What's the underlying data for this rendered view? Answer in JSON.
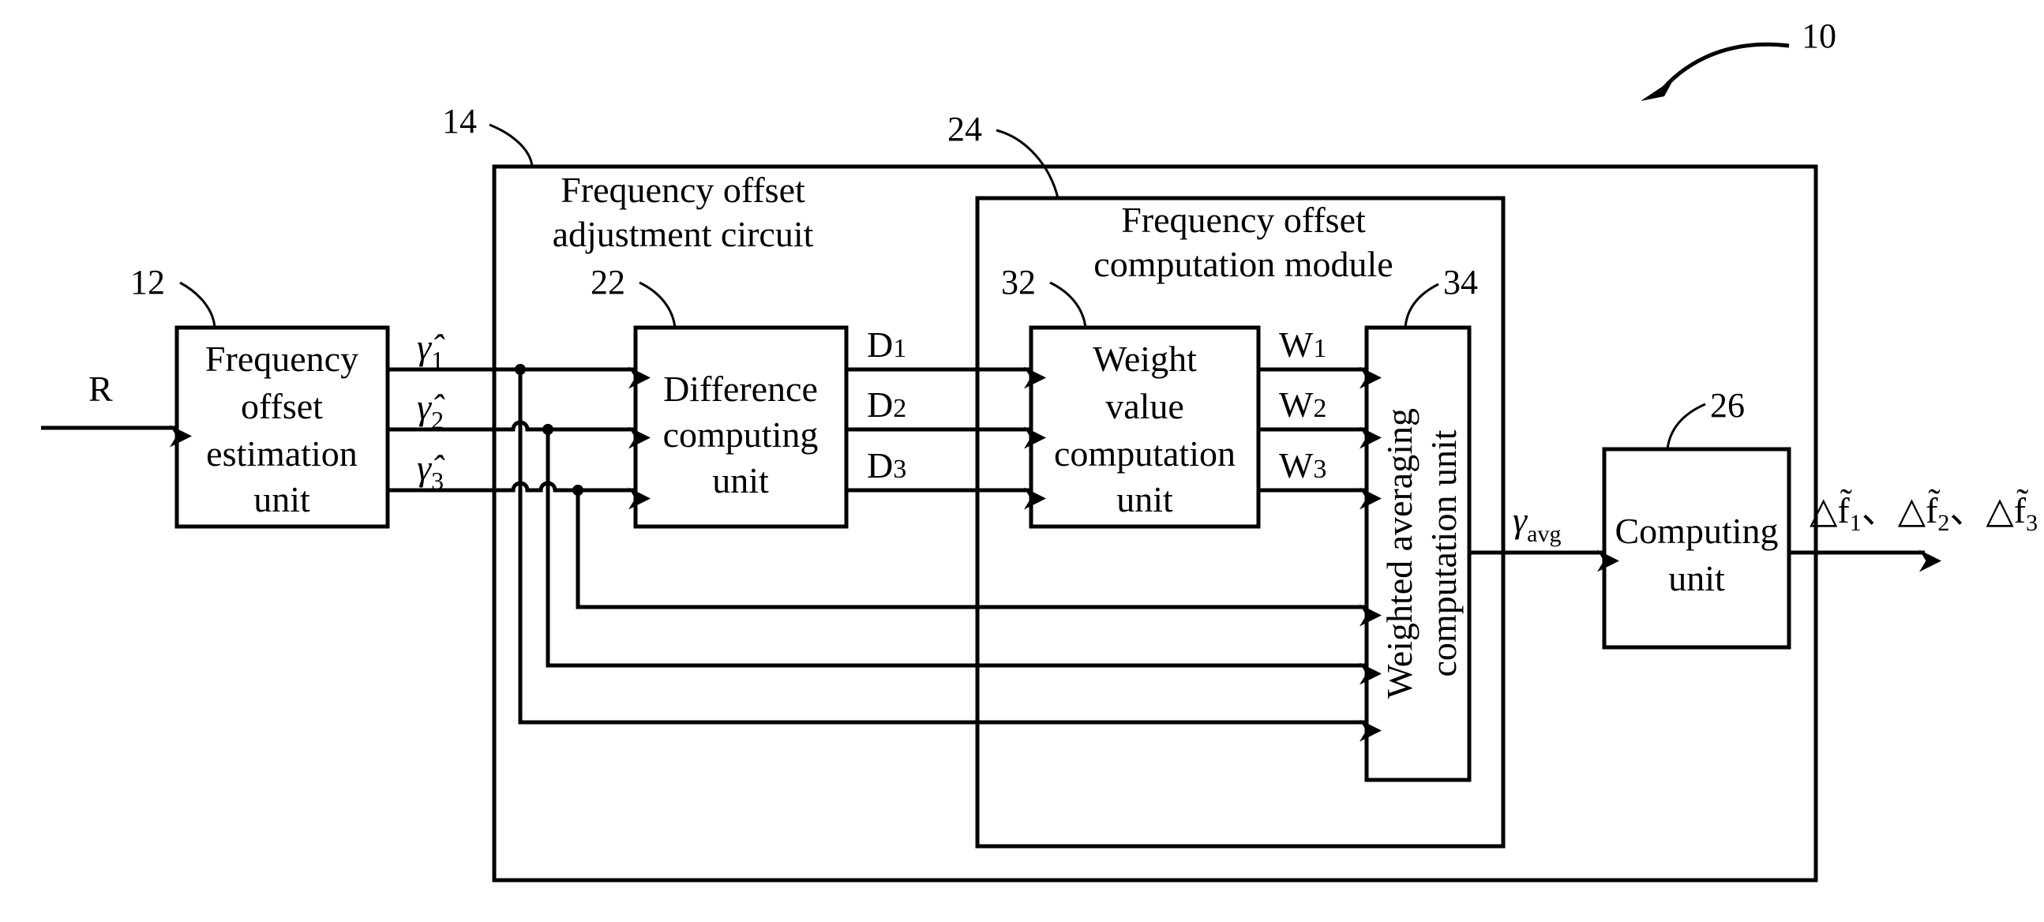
{
  "figure_ref": "10",
  "blocks": {
    "estimation": {
      "ref": "12",
      "lines": [
        "Frequency",
        "offset",
        "estimation",
        "unit"
      ]
    },
    "adjustment_circuit": {
      "ref": "14",
      "lines": [
        "Frequency offset",
        "adjustment circuit"
      ]
    },
    "difference": {
      "ref": "22",
      "lines": [
        "Difference",
        "computing",
        "unit"
      ]
    },
    "computation_module": {
      "ref": "24",
      "lines": [
        "Frequency offset",
        "computation module"
      ]
    },
    "weight_value": {
      "ref": "32",
      "lines": [
        "Weight",
        "value",
        "computation",
        "unit"
      ]
    },
    "weighted_avg": {
      "ref": "34",
      "lines": [
        "Weighted averaging",
        "computation unit"
      ]
    },
    "computing": {
      "ref": "26",
      "lines": [
        "Computing",
        "unit"
      ]
    }
  },
  "signals": {
    "input": "R",
    "r_hat": [
      {
        "sym": "γ̂",
        "sub": "1"
      },
      {
        "sym": "γ̂",
        "sub": "2"
      },
      {
        "sym": "γ̂",
        "sub": "3"
      }
    ],
    "d": [
      {
        "sym": "D",
        "sub": "1"
      },
      {
        "sym": "D",
        "sub": "2"
      },
      {
        "sym": "D",
        "sub": "3"
      }
    ],
    "w": [
      {
        "sym": "W",
        "sub": "1"
      },
      {
        "sym": "W",
        "sub": "2"
      },
      {
        "sym": "W",
        "sub": "3"
      }
    ],
    "r_avg": {
      "sym": "γ",
      "sub": "avg"
    },
    "outputs": [
      {
        "sym": "△f̃",
        "sub": "1"
      },
      {
        "sym": "△f̃",
        "sub": "2"
      },
      {
        "sym": "△f̃",
        "sub": "3"
      }
    ],
    "separator": "、"
  }
}
